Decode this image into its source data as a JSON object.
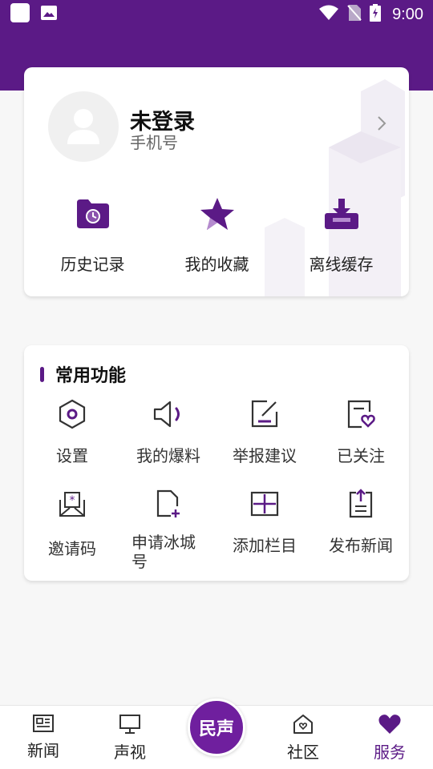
{
  "status_bar": {
    "time": "9:00"
  },
  "profile": {
    "title": "未登录",
    "subtitle": "手机号"
  },
  "quick_actions": [
    {
      "label": "历史记录",
      "icon": "history-folder-icon"
    },
    {
      "label": "我的收藏",
      "icon": "star-icon"
    },
    {
      "label": "离线缓存",
      "icon": "download-icon"
    }
  ],
  "functions": {
    "title": "常用功能",
    "items": [
      {
        "label": "设置",
        "icon": "settings-icon"
      },
      {
        "label": "我的爆料",
        "icon": "speaker-icon"
      },
      {
        "label": "举报建议",
        "icon": "edit-icon"
      },
      {
        "label": "已关注",
        "icon": "follow-doc-icon"
      },
      {
        "label": "邀请码",
        "icon": "invite-envelope-icon"
      },
      {
        "label": "申请冰城号",
        "icon": "apply-doc-icon"
      },
      {
        "label": "添加栏目",
        "icon": "add-column-icon"
      },
      {
        "label": "发布新闻",
        "icon": "publish-icon"
      }
    ]
  },
  "bottom_nav": {
    "items": [
      {
        "label": "新闻",
        "icon": "news-icon"
      },
      {
        "label": "声视",
        "icon": "monitor-icon"
      },
      {
        "label": "社区",
        "icon": "community-home-icon"
      },
      {
        "label": "服务",
        "icon": "heart-icon",
        "active": true
      }
    ],
    "center_label": "民声"
  },
  "colors": {
    "brand": "#5b1a86",
    "accent": "#6f1f9e",
    "background": "#f7f7f7"
  }
}
